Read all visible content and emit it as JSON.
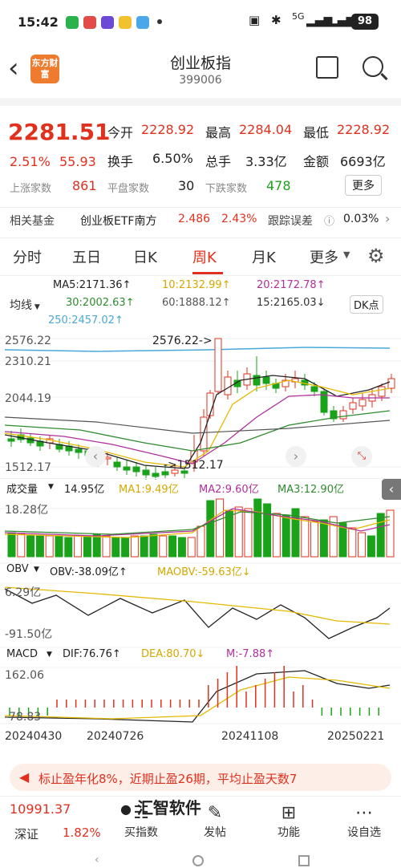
{
  "status": {
    "time": "15:42",
    "battery": "98",
    "network": "5G"
  },
  "header": {
    "title": "创业板指",
    "code": "399006",
    "logo_text": "东方财富"
  },
  "quote": {
    "price": "2281.51",
    "change_pct": "2.51%",
    "change_abs": "55.93",
    "open_label": "今开",
    "open": "2228.92",
    "high_label": "最高",
    "high": "2284.04",
    "low_label": "最低",
    "low": "2228.92",
    "turnover_label": "换手",
    "turnover": "6.50%",
    "volume_label": "总手",
    "volume": "3.33亿",
    "amount_label": "金额",
    "amount": "6693亿",
    "up_label": "上涨家数",
    "up": "861",
    "flat_label": "平盘家数",
    "flat": "30",
    "down_label": "下跌家数",
    "down": "478",
    "more_label": "更多"
  },
  "fund": {
    "label": "相关基金",
    "name": "创业板ETF南方",
    "price": "2.486",
    "pct": "2.43%",
    "track_label": "跟踪误差",
    "track": "0.03%"
  },
  "tabs": [
    "分时",
    "五日",
    "日K",
    "周K",
    "月K",
    "更多"
  ],
  "active_tab": "周K",
  "ma": {
    "ma5": "MA5:2171.36↑",
    "ma10": "10:2132.99↑",
    "ma20": "20:2172.78↑",
    "ma30": "30:2002.63↑",
    "ma60": "60:1888.12↑",
    "ma15": "15:2165.03↓",
    "ma250": "250:2457.02↑",
    "mode": "均线",
    "dk": "DK点"
  },
  "kline": {
    "y_top": "2576.22",
    "y_mid": "2310.21",
    "y_low_mid": "2044.19",
    "y_bottom": "1512.17",
    "max_annot": "2576.22->",
    "min_annot": "->1512.17"
  },
  "volume": {
    "label": "成交量",
    "value": "14.95亿",
    "ma1": "MA1:9.49亿",
    "ma2": "MA2:9.60亿",
    "ma3": "MA3:12.90亿",
    "y_top": "18.28亿"
  },
  "obv": {
    "label": "OBV",
    "value": "OBV:-38.09亿↑",
    "maobv": "MAOBV:-59.63亿↓",
    "y_top": "6.29亿",
    "y_bottom": "-91.50亿"
  },
  "macd": {
    "label": "MACD",
    "dif": "DIF:76.76↑",
    "dea": "DEA:80.70↓",
    "m": "M:-7.88↑",
    "y_top": "162.06",
    "y_bottom": "-78.83"
  },
  "dates": [
    "20240430",
    "20240726",
    "20241108",
    "20250221"
  ],
  "banner": {
    "text": "标止盈年化8%，近期止盈26期，平均止盈天数7"
  },
  "bottom": {
    "index_value": "10991.37",
    "index_name": "深证",
    "index_pct": "1.82%",
    "items": [
      "买指数",
      "发帖",
      "功能",
      "设自选"
    ],
    "overlay": "汇智软件"
  },
  "colors": {
    "up": "#e0301e",
    "down": "#1aa31a",
    "ma5": "#222222",
    "ma10": "#e6b800",
    "ma20": "#b0309c",
    "ma30": "#2e8b2e",
    "ma250": "#4aa8d8"
  },
  "chart_data": {
    "type": "candlestick",
    "dates": [
      "20240430",
      "20240726",
      "20241108",
      "20250221"
    ],
    "y_range": [
      1512.17,
      2576.22
    ],
    "max": 2576.22,
    "min": 1512.17,
    "indicators": [
      "MA5",
      "MA10",
      "MA20",
      "MA30",
      "MA60",
      "MA15",
      "MA250",
      "VOL",
      "OBV",
      "MACD"
    ]
  }
}
